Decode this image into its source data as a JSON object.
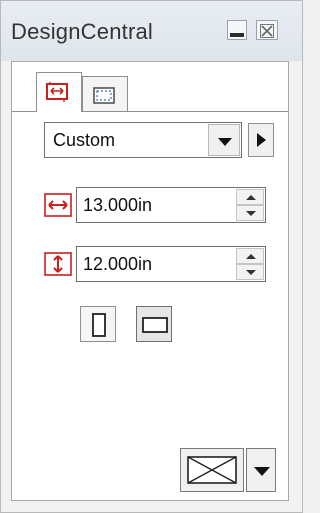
{
  "window": {
    "title": "DesignCentral"
  },
  "tabs": [
    {
      "name": "page-size",
      "icon": "page-size-icon"
    },
    {
      "name": "page-border",
      "icon": "page-border-icon"
    }
  ],
  "page_size": {
    "preset": "Custom",
    "width": "13.000in",
    "height": "12.000in",
    "orientation_selected": "landscape"
  },
  "colors": {
    "accent_red": "#cc1f1f",
    "title_bg": "#e3e9f0"
  }
}
